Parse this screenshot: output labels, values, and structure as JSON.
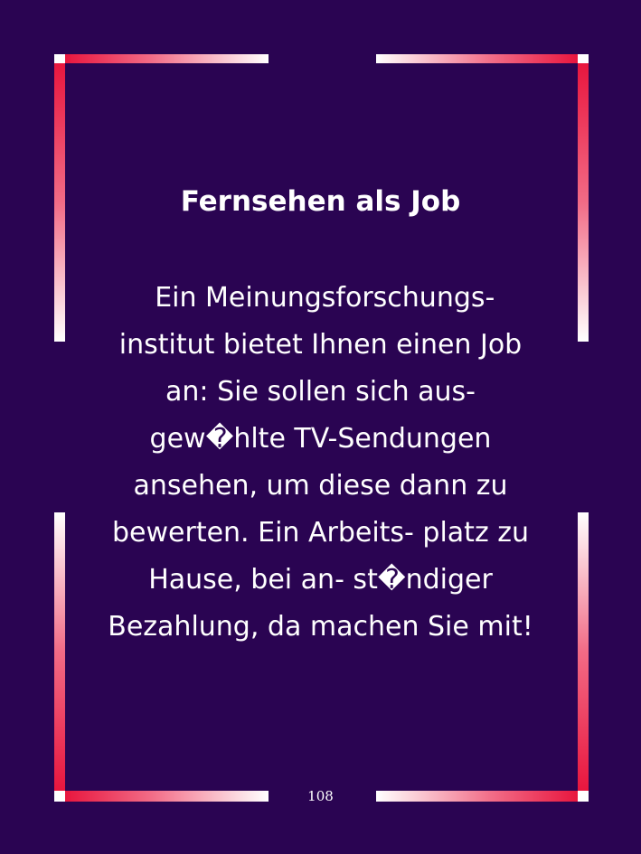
{
  "page": {
    "title": "Fernsehen als Job",
    "lines": [
      " Ein Meinungsforschungs-",
      "institut bietet Ihnen einen Job",
      "an: Sie sollen sich aus-",
      "gew�hlte TV-Sendungen",
      "ansehen, um diese dann zu",
      "bewerten. Ein Arbeits- platz zu",
      "Hause, bei an- st�ndiger",
      "Bezahlung, da machen Sie mit!"
    ],
    "page_number": "108"
  },
  "colors": {
    "background": "#2a0452",
    "frame_red": "#e8163e",
    "frame_white": "#ffffff",
    "text": "#ffffff"
  }
}
